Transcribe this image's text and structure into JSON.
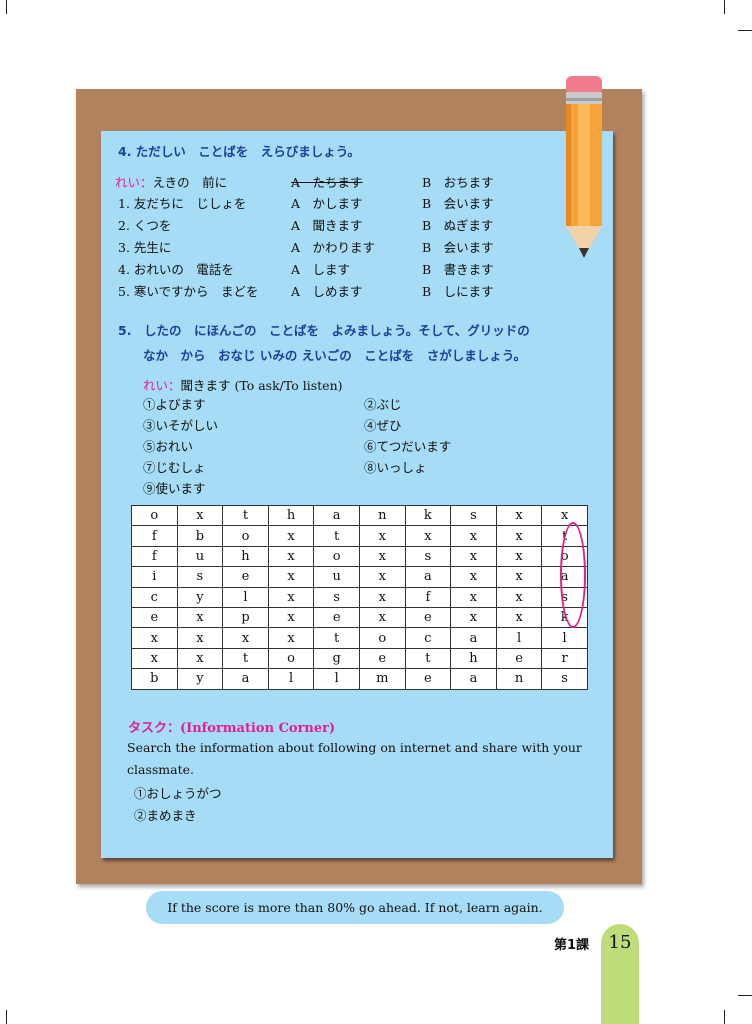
{
  "section4": {
    "heading": "4. ただしい　ことばを　えらびましょう。",
    "example": {
      "label": "れい：",
      "text": "えきの　前に",
      "a": "A　たちます",
      "b": "B　おちます"
    },
    "rows": [
      {
        "text": "1. 友だちに　じしょを",
        "a": "A　かします",
        "b": "B　会います"
      },
      {
        "text": "2. くつを",
        "a": "A　聞きます",
        "b": "B　ぬぎます"
      },
      {
        "text": "3. 先生に",
        "a": "A　かわります",
        "b": "B　会います"
      },
      {
        "text": "4. おれいの　電話を",
        "a": "A　します",
        "b": "B　書きます"
      },
      {
        "text": "5. 寒いですから　まどを",
        "a": "A　しめます",
        "b": "B　しにます"
      }
    ]
  },
  "section5": {
    "heading_line1": "5.　したの　にほんごの　ことばを　よみましょう。そして、グリッドの",
    "heading_line2": "なか　から　おなじ いみの えいごの　ことばを　さがしましょう。",
    "example_label": "れい：",
    "example_text": "聞きます (To ask/To listen)",
    "words": [
      "①よびます",
      "②ぶじ",
      "③いそがしい",
      "④ぜひ",
      "⑤おれい",
      "⑥てつだいます",
      "⑦じむしょ",
      "⑧いっしょ",
      "⑨使います"
    ]
  },
  "grid": [
    [
      "o",
      "x",
      "t",
      "h",
      "a",
      "n",
      "k",
      "s",
      "x",
      "x"
    ],
    [
      "f",
      "b",
      "o",
      "x",
      "t",
      "x",
      "x",
      "x",
      "x",
      "t"
    ],
    [
      "f",
      "u",
      "h",
      "x",
      "o",
      "x",
      "s",
      "x",
      "x",
      "o"
    ],
    [
      "i",
      "s",
      "e",
      "x",
      "u",
      "x",
      "a",
      "x",
      "x",
      "a"
    ],
    [
      "c",
      "y",
      "l",
      "x",
      "s",
      "x",
      "f",
      "x",
      "x",
      "s"
    ],
    [
      "e",
      "x",
      "p",
      "x",
      "e",
      "x",
      "e",
      "x",
      "x",
      "k"
    ],
    [
      "x",
      "x",
      "x",
      "x",
      "t",
      "o",
      "c",
      "a",
      "l",
      "l"
    ],
    [
      "x",
      "x",
      "t",
      "o",
      "g",
      "e",
      "t",
      "h",
      "e",
      "r"
    ],
    [
      "b",
      "y",
      "a",
      "l",
      "l",
      "m",
      "e",
      "a",
      "n",
      "s"
    ]
  ],
  "task": {
    "title": "タスク：(Information Corner)",
    "line1": "Search the information about following  on internet and share with your",
    "line2": "classmate.",
    "items": [
      "①おしょうがつ",
      "②まめまき"
    ]
  },
  "footer": {
    "note": "If the score is more than 80% go ahead. If not, learn again.",
    "lesson": "第1課",
    "page": "15"
  },
  "colors": {
    "board": "#b0825d",
    "card": "#a6dcf5",
    "heading": "#1f3f9a",
    "accent": "#e0218a",
    "tab": "#bedc7a"
  }
}
